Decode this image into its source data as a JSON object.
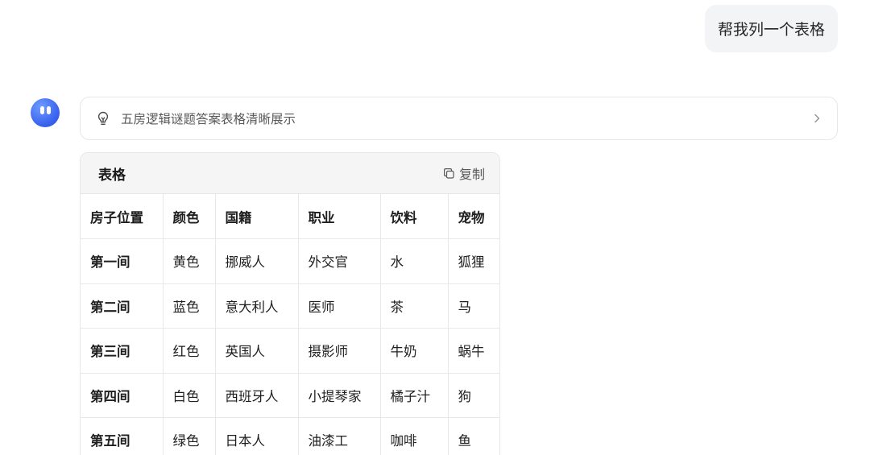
{
  "user_message": "帮我列一个表格",
  "thinking": {
    "label": "五房逻辑谜题答案表格清晰展示"
  },
  "table_card": {
    "title": "表格",
    "copy_label": "复制",
    "headers": [
      "房子位置",
      "颜色",
      "国籍",
      "职业",
      "饮料",
      "宠物"
    ],
    "rows": [
      [
        "第一间",
        "黄色",
        "挪威人",
        "外交官",
        "水",
        "狐狸"
      ],
      [
        "第二间",
        "蓝色",
        "意大利人",
        "医师",
        "茶",
        "马"
      ],
      [
        "第三间",
        "红色",
        "英国人",
        "摄影师",
        "牛奶",
        "蜗牛"
      ],
      [
        "第四间",
        "白色",
        "西班牙人",
        "小提琴家",
        "橘子汁",
        "狗"
      ],
      [
        "第五间",
        "绿色",
        "日本人",
        "油漆工",
        "咖啡",
        "鱼"
      ]
    ]
  },
  "icons": {
    "avatar": "assistant-avatar",
    "thinking": "lightbulb-icon",
    "expand": "chevron-right-icon",
    "copy": "copy-icon"
  },
  "colors": {
    "avatar_blue": "#3a63ee",
    "bubble_bg": "#f3f4f6",
    "card_header_bg": "#f5f5f5"
  }
}
